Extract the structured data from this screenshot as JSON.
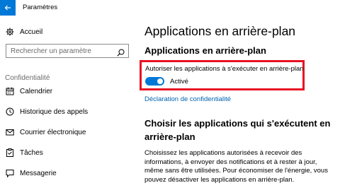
{
  "window": {
    "title": "Paramètres"
  },
  "sidebar": {
    "home_label": "Accueil",
    "search_placeholder": "Rechercher un paramètre",
    "section_label": "Confidentialité",
    "items": [
      {
        "label": "Calendrier",
        "icon": "calendar-icon"
      },
      {
        "label": "Historique des appels",
        "icon": "call-history-icon"
      },
      {
        "label": "Courrier électronique",
        "icon": "mail-icon"
      },
      {
        "label": "Tâches",
        "icon": "tasks-icon"
      },
      {
        "label": "Messagerie",
        "icon": "messaging-icon"
      }
    ]
  },
  "main": {
    "title": "Applications en arrière-plan",
    "subheading": "Applications en arrière-plan",
    "toggle_label": "Autoriser les applications à s'exécuter en arrière-plan",
    "toggle_state": "Activé",
    "toggle_on": true,
    "privacy_link": "Déclaration de confidentialité",
    "section2_title": "Choisir les applications qui s'exécutent en arrière-plan",
    "section2_desc": "Choisissez les applications autorisées à recevoir des informations, à envoyer des notifications et à rester à jour, même sans être utilisées. Pour économiser de l'énergie, vous pouvez désactiver les applications en arrière-plan."
  },
  "colors": {
    "accent": "#0078d7",
    "highlight": "#e81123",
    "link": "#0063b1"
  }
}
